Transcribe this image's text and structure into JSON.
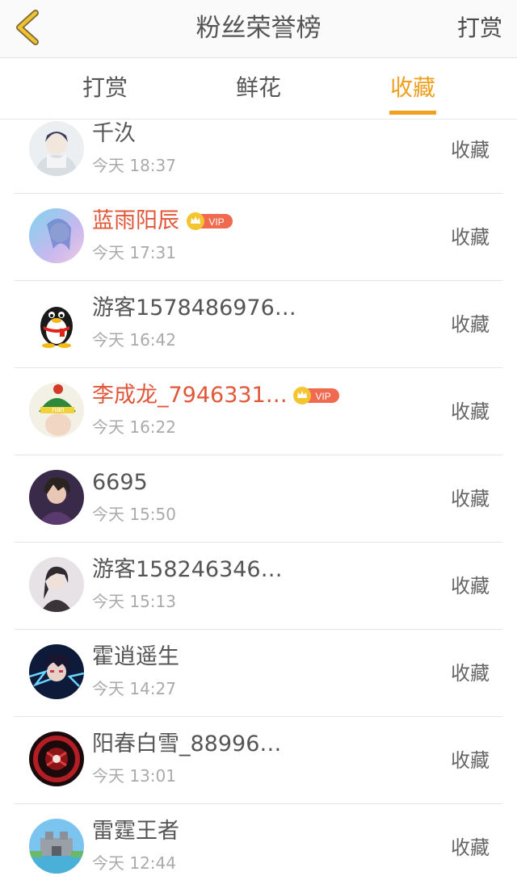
{
  "header": {
    "title": "粉丝荣誉榜",
    "right_label": "打赏",
    "back_icon": "chevron-left-icon",
    "accent_color": "#f0a020"
  },
  "tabs": [
    {
      "label": "打赏",
      "active": false
    },
    {
      "label": "鲜花",
      "active": false
    },
    {
      "label": "收藏",
      "active": true
    }
  ],
  "list": [
    {
      "name": "千汣",
      "time": "今天 18:37",
      "action": "收藏",
      "vip": false
    },
    {
      "name": "蓝雨阳辰",
      "time": "今天 17:31",
      "action": "收藏",
      "vip": true
    },
    {
      "name": "游客1578486976…",
      "time": "今天 16:42",
      "action": "收藏",
      "vip": false
    },
    {
      "name": "李成龙_7946331…",
      "time": "今天 16:22",
      "action": "收藏",
      "vip": true
    },
    {
      "name": "6695",
      "time": "今天 15:50",
      "action": "收藏",
      "vip": false
    },
    {
      "name": "游客158246346…",
      "time": "今天 15:13",
      "action": "收藏",
      "vip": false
    },
    {
      "name": "霍逍遥生",
      "time": "今天 14:27",
      "action": "收藏",
      "vip": false
    },
    {
      "name": "阳春白雪_88996…",
      "time": "今天 13:01",
      "action": "收藏",
      "vip": false
    },
    {
      "name": "雷霆王者",
      "time": "今天 12:44",
      "action": "收藏",
      "vip": false
    }
  ],
  "vip_badge_text": "VIP"
}
